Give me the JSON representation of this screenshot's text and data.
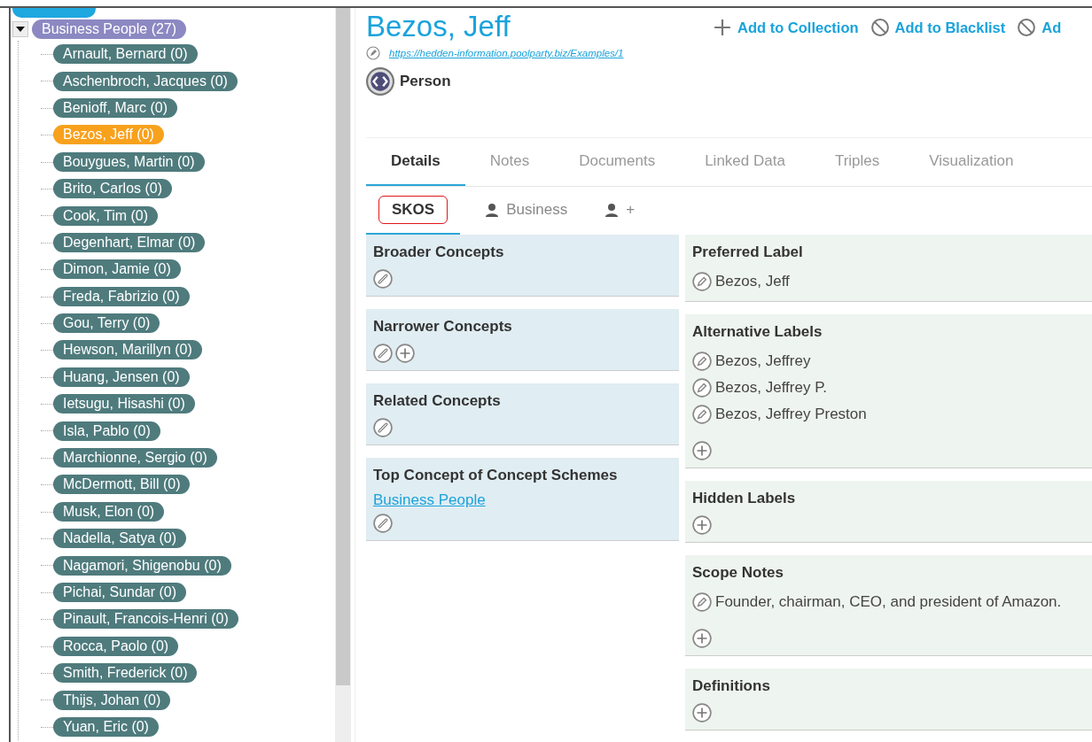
{
  "tree": {
    "root": {
      "kind": "domain",
      "selected": false
    },
    "nodes": [
      {
        "label": "Business People (27)",
        "kind": "category",
        "expanded": true,
        "selected": false,
        "children": [
          {
            "label": "Arnault, Bernard (0)",
            "selected": false
          },
          {
            "label": "Aschenbroch, Jacques (0)",
            "selected": false
          },
          {
            "label": "Benioff, Marc (0)",
            "selected": false
          },
          {
            "label": "Bezos, Jeff (0)",
            "selected": true
          },
          {
            "label": "Bouygues, Martin (0)",
            "selected": false
          },
          {
            "label": "Brito, Carlos (0)",
            "selected": false
          },
          {
            "label": "Cook, Tim (0)",
            "selected": false
          },
          {
            "label": "Degenhart, Elmar (0)",
            "selected": false
          },
          {
            "label": "Dimon, Jamie (0)",
            "selected": false
          },
          {
            "label": "Freda, Fabrizio (0)",
            "selected": false
          },
          {
            "label": "Gou, Terry (0)",
            "selected": false
          },
          {
            "label": "Hewson, Marillyn (0)",
            "selected": false
          },
          {
            "label": "Huang, Jensen (0)",
            "selected": false
          },
          {
            "label": "Ietsugu, Hisashi (0)",
            "selected": false
          },
          {
            "label": "Isla, Pablo (0)",
            "selected": false
          },
          {
            "label": "Marchionne, Sergio (0)",
            "selected": false
          },
          {
            "label": "McDermott, Bill (0)",
            "selected": false
          },
          {
            "label": "Musk, Elon (0)",
            "selected": false
          },
          {
            "label": "Nadella, Satya (0)",
            "selected": false
          },
          {
            "label": "Nagamori, Shigenobu (0)",
            "selected": false
          },
          {
            "label": "Pichai, Sundar (0)",
            "selected": false
          },
          {
            "label": "Pinault, Francois-Henri (0)",
            "selected": false
          },
          {
            "label": "Rocca, Paolo (0)",
            "selected": false
          },
          {
            "label": "Smith, Frederick (0)",
            "selected": false
          },
          {
            "label": "Thijs, Johan (0)",
            "selected": false
          },
          {
            "label": "Yuan, Eric (0)",
            "selected": false
          }
        ]
      }
    ]
  },
  "concept": {
    "title": "Bezos, Jeff",
    "uri": "https://hedden-information.poolparty.biz/Examples/1",
    "type": "Person",
    "actions": [
      {
        "label": "Add to Collection",
        "kind": "add"
      },
      {
        "label": "Add to Blacklist",
        "kind": "block"
      },
      {
        "label": "Ad",
        "kind": "block"
      }
    ]
  },
  "tabs": [
    {
      "label": "Details",
      "selected": true
    },
    {
      "label": "Notes",
      "selected": false
    },
    {
      "label": "Documents",
      "selected": false
    },
    {
      "label": "Linked Data",
      "selected": false
    },
    {
      "label": "Triples",
      "selected": false
    },
    {
      "label": "Visualization",
      "selected": false
    }
  ],
  "subtabs": [
    {
      "label": "SKOS",
      "kind": "text",
      "selected": true
    },
    {
      "label": "Business",
      "kind": "person",
      "selected": false
    },
    {
      "label": "+",
      "kind": "person",
      "selected": false
    }
  ],
  "relations": [
    {
      "title": "Broader Concepts",
      "buttons": [
        {
          "kind": "link"
        }
      ]
    },
    {
      "title": "Narrower Concepts",
      "buttons": [
        {
          "kind": "link"
        },
        {
          "kind": "add"
        }
      ]
    },
    {
      "title": "Related Concepts",
      "buttons": [
        {
          "kind": "link"
        }
      ]
    },
    {
      "title": "Top Concept of Concept Schemes",
      "links": [
        "Business People"
      ],
      "buttons": [
        {
          "kind": "link"
        }
      ]
    }
  ],
  "labels": [
    {
      "title": "Preferred Label",
      "values": [
        "Bezos, Jeff"
      ]
    },
    {
      "title": "Alternative Labels",
      "values": [
        "Bezos, Jeffrey",
        "Bezos, Jeffrey P.",
        "Bezos, Jeffrey Preston"
      ],
      "buttons": [
        {
          "kind": "add"
        }
      ]
    },
    {
      "title": "Hidden Labels",
      "buttons": [
        {
          "kind": "add"
        }
      ]
    },
    {
      "title": "Scope Notes",
      "values": [
        "Founder, chairman, CEO, and president of Amazon."
      ],
      "buttons": [
        {
          "kind": "add"
        }
      ]
    },
    {
      "title": "Definitions",
      "buttons": [
        {
          "kind": "add"
        }
      ]
    }
  ]
}
